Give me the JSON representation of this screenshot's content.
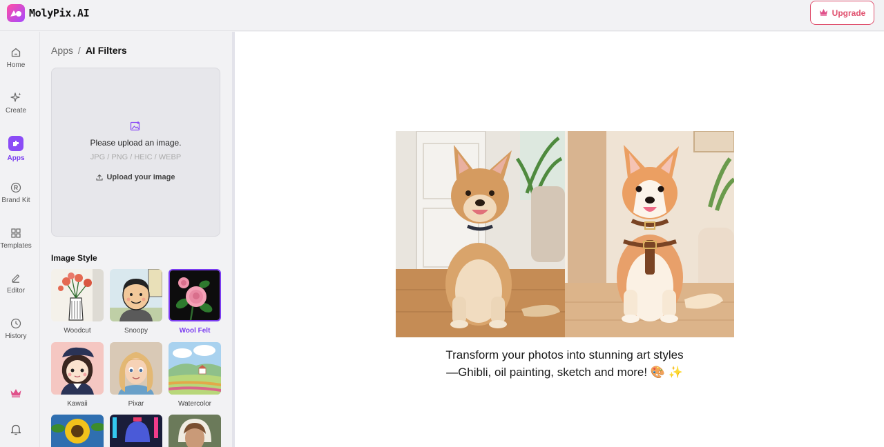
{
  "header": {
    "brand": "MolyPix.AI",
    "upgrade_label": "Upgrade"
  },
  "sidebar": {
    "items": [
      {
        "label": "Home",
        "icon": "home-icon"
      },
      {
        "label": "Create",
        "icon": "sparkle-icon"
      },
      {
        "label": "Apps",
        "icon": "apps-icon",
        "active": true
      },
      {
        "label": "Brand Kit",
        "icon": "registered-icon"
      },
      {
        "label": "Templates",
        "icon": "grid-icon"
      },
      {
        "label": "Editor",
        "icon": "pencil-icon"
      },
      {
        "label": "History",
        "icon": "clock-icon"
      }
    ],
    "bottom_icons": [
      "crown-icon",
      "bell-icon"
    ]
  },
  "panel": {
    "breadcrumb": {
      "root": "Apps",
      "separator": "/",
      "current": "AI Filters"
    },
    "upload": {
      "prompt": "Please upload an image.",
      "formats": "JPG / PNG / HEIC / WEBP",
      "button_label": "Upload your image"
    },
    "image_style": {
      "heading": "Image Style",
      "styles": [
        {
          "label": "Woodcut"
        },
        {
          "label": "Snoopy"
        },
        {
          "label": "Wool Felt",
          "selected": true
        },
        {
          "label": "Kawaii"
        },
        {
          "label": "Pixar"
        },
        {
          "label": "Watercolor"
        }
      ]
    }
  },
  "main": {
    "tagline": "Transform your photos into stunning art styles—Ghibli, oil painting, sketch and more! 🎨 ✨"
  },
  "colors": {
    "accent": "#7a3cf0",
    "upgrade": "#e0506e",
    "crown": "#e0508a"
  }
}
